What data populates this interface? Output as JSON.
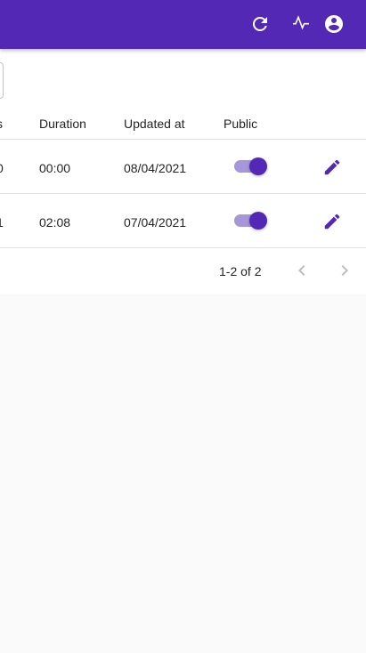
{
  "colors": {
    "primary": "#5328b5",
    "switch_track": "#a597d8",
    "background": "#fafafa"
  },
  "appbar": {
    "icons": [
      "refresh-icon",
      "activity-icon",
      "account-circle-icon"
    ]
  },
  "table": {
    "headers": [
      "s",
      "Duration",
      "Updated at",
      "Public"
    ],
    "rows": [
      {
        "partial": "0",
        "duration": "00:00",
        "updated_at": "08/04/2021",
        "public": true
      },
      {
        "partial": "1",
        "duration": "02:08",
        "updated_at": "07/04/2021",
        "public": true
      }
    ]
  },
  "pagination": {
    "range_text": "1-2 of 2"
  }
}
